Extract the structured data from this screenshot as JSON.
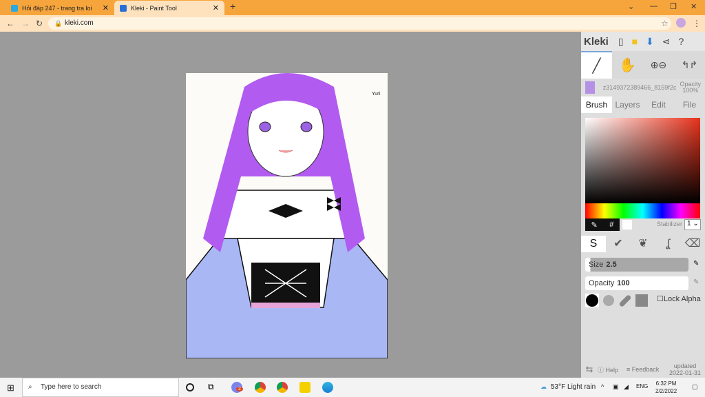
{
  "browser": {
    "tabs": [
      {
        "title": "Hỏi đáp 247 - trang tra loi",
        "close": "✕"
      },
      {
        "title": "Kleki - Paint Tool",
        "close": "✕"
      }
    ],
    "new_tab": "+",
    "url": "kleki.com",
    "window_controls": [
      "⌄",
      "—",
      "❐",
      "✕"
    ]
  },
  "app": {
    "logo": "Kleki",
    "layer_name": "z3149372389466_8159f2c",
    "layer_opacity_label": "Opacity",
    "layer_opacity": "100%",
    "tabs": [
      "Brush",
      "Layers",
      "Edit",
      "File"
    ],
    "active_tab": "Brush",
    "stabilizer_label": "Stabilizer",
    "stabilizer_value": "1",
    "size_label": "Size",
    "size_value": "2.5",
    "size_fraction": 0.05,
    "opacity_label": "Opacity",
    "opacity_value": "100",
    "lock_alpha": "Lock Alpha",
    "help": "Help",
    "feedback": "Feedback",
    "updated_label": "updated",
    "updated_date": "2022-01-31",
    "colors": {
      "primary": "#000000",
      "secondary": "#ffffff",
      "hue": "#e8321b"
    }
  },
  "canvas": {
    "signature": "Yuri"
  },
  "taskbar": {
    "search_placeholder": "Type here to search",
    "weather": "53°F  Light rain",
    "lang": "ENG",
    "time": "6:32 PM",
    "date": "2/2/2022",
    "badge": "2"
  }
}
